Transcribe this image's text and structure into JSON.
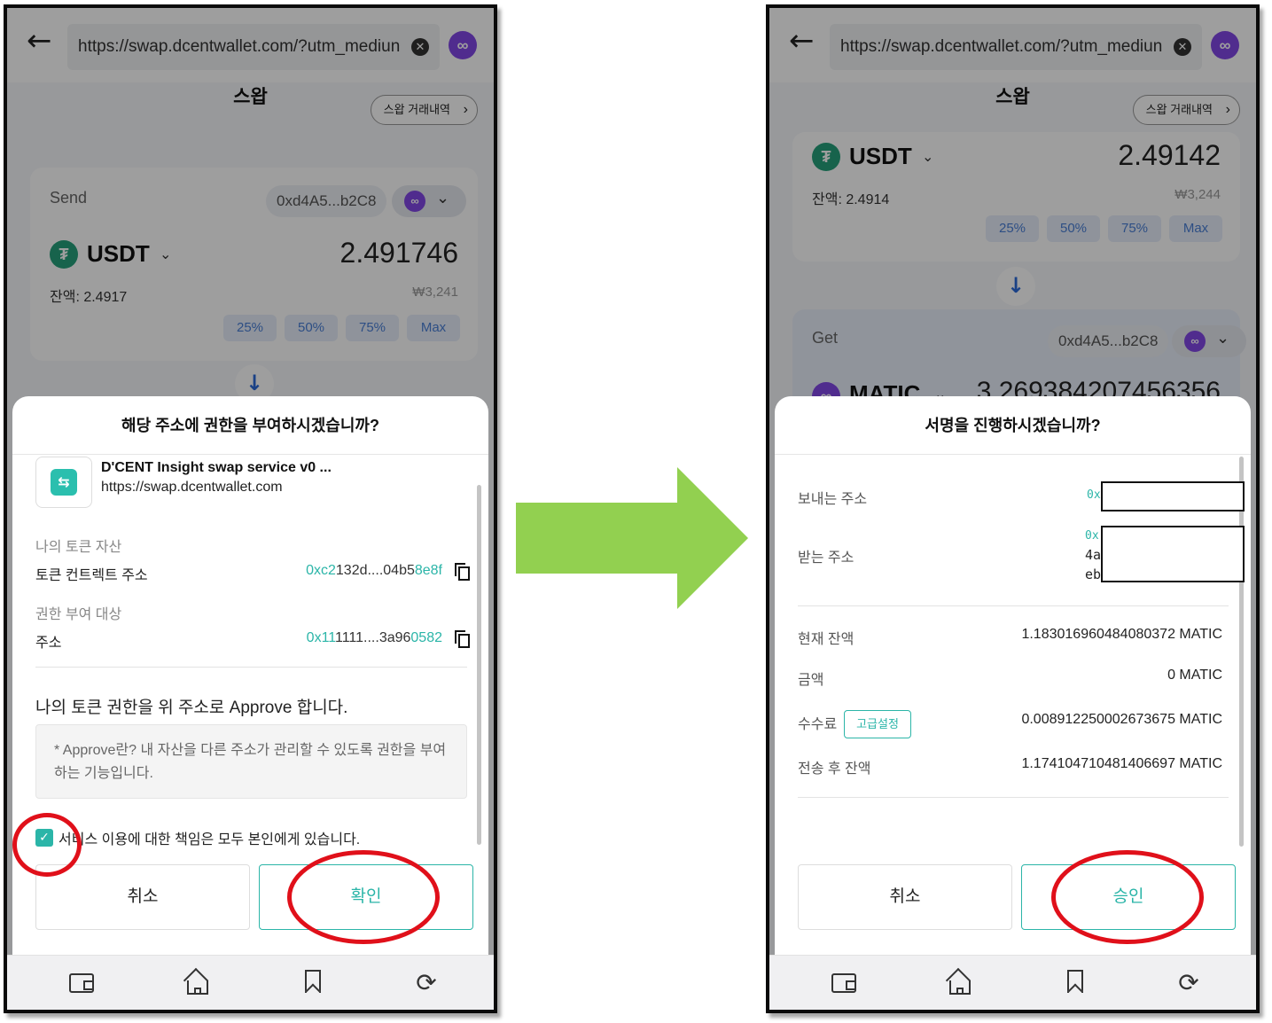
{
  "colors": {
    "accent_teal": "#2bb5a8",
    "polygon_purple": "#8247e5",
    "tether_green": "#26a17b",
    "highlight_red": "#e0101a",
    "arrow_green": "#92d050"
  },
  "browser": {
    "url": "https://swap.dcentwallet.com/?utm_mediun",
    "back_icon": "back-arrow-icon",
    "clear_icon": "clear-icon",
    "network_icon": "polygon-icon"
  },
  "page": {
    "title": "스왑",
    "history_button": "스왑 거래내역"
  },
  "left": {
    "send_card": {
      "label": "Send",
      "address": "0xd4A5...b2C8",
      "token": "USDT",
      "amount": "2.491746",
      "balance": "잔액: 2.4917",
      "krw": "₩3,241",
      "percent_buttons": [
        "25%",
        "50%",
        "75%",
        "Max"
      ]
    },
    "dialog": {
      "title": "해당 주소에 권한을 부여하시겠습니까?",
      "app_name": "D'CENT Insight swap service v0 ...",
      "app_url": "https://swap.dcentwallet.com",
      "section_token_assets": "나의 토큰 자산",
      "contract_label": "토큰 컨트렉트 주소",
      "contract_prefix": "0xc2",
      "contract_middle": "132d....04b5",
      "contract_suffix": "8e8f",
      "section_grantee": "권한 부여 대상",
      "address_label": "주소",
      "grantee_prefix": "0x11",
      "grantee_middle": "1111....3a96",
      "grantee_suffix": "0582",
      "approve_text": "나의 토큰 권한을 위 주소로 Approve 합니다.",
      "note": "* Approve란? 내 자산을 다른 주소가 관리할 수 있도록 권한을 부여하는 기능입니다.",
      "checkbox_label": "서비스 이용에 대한 책임은 모두 본인에게 있습니다.",
      "checkbox_checked": true,
      "cancel": "취소",
      "confirm": "확인"
    }
  },
  "right": {
    "send_card": {
      "token": "USDT",
      "amount": "2.49142",
      "balance": "잔액: 2.4914",
      "krw": "₩3,244",
      "percent_buttons": [
        "25%",
        "50%",
        "75%",
        "Max"
      ]
    },
    "get_card": {
      "label": "Get",
      "address": "0xd4A5...b2C8",
      "token": "MATIC",
      "amount": "3.269384207456356"
    },
    "dialog": {
      "title": "서명을 진행하시겠습니까?",
      "from_label": "보내는 주소",
      "from_value": "0x",
      "to_label": "받는 주소",
      "to_value_line1": "0x",
      "to_value_line2": "4a",
      "to_value_line3": "eb",
      "current_balance_label": "현재 잔액",
      "current_balance": "1.183016960484080372 MATIC",
      "amount_label": "금액",
      "amount": "0 MATIC",
      "fee_label": "수수료",
      "advanced_button": "고급설정",
      "fee": "0.008912250002673675 MATIC",
      "after_balance_label": "전송 후 잔액",
      "after_balance": "1.174104710481406697 MATIC",
      "cancel": "취소",
      "confirm": "승인"
    }
  },
  "navbar": [
    "wallet-icon",
    "home-icon",
    "bookmark-icon",
    "sync-icon"
  ]
}
